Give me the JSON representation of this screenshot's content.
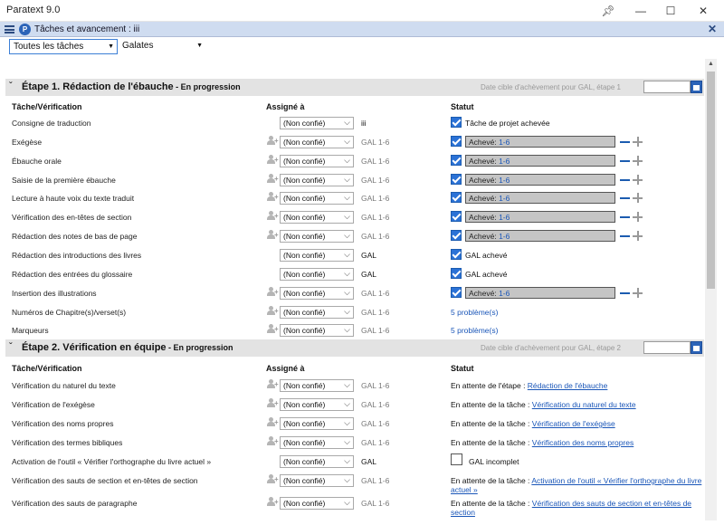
{
  "window": {
    "title": "Paratext 9.0"
  },
  "pane": {
    "title": "Tâches et avancement : iii"
  },
  "toolbar": {
    "filter_value": "Toutes les tâches",
    "book_value": "Galates"
  },
  "columns": {
    "task": "Tâche/Vérification",
    "assigned": "Assigné à",
    "status": "Statut"
  },
  "stage1": {
    "title": "Étape 1. Rédaction de l'ébauche",
    "status": " - En progression",
    "target_label": "Date cible d'achèvement pour GAL, étape 1",
    "rows": [
      {
        "task": "Consigne de traduction",
        "assigned": "(Non confié)",
        "scope": "iii",
        "status_text": "Tâche de projet achevée"
      },
      {
        "task": "Exégèse",
        "assigned": "(Non confié)",
        "scope": "GAL 1-6",
        "prog_label": "Achevé: ",
        "prog_value": "1-6"
      },
      {
        "task": "Ébauche orale",
        "assigned": "(Non confié)",
        "scope": "GAL 1-6",
        "prog_label": "Achevé: ",
        "prog_value": "1-6"
      },
      {
        "task": "Saisie de la première ébauche",
        "assigned": "(Non confié)",
        "scope": "GAL 1-6",
        "prog_label": "Achevé: ",
        "prog_value": "1-6"
      },
      {
        "task": "Lecture à haute voix du texte traduit",
        "assigned": "(Non confié)",
        "scope": "GAL 1-6",
        "prog_label": "Achevé: ",
        "prog_value": "1-6"
      },
      {
        "task": "Vérification des en-têtes de section",
        "assigned": "(Non confié)",
        "scope": "GAL 1-6",
        "prog_label": "Achevé: ",
        "prog_value": "1-6"
      },
      {
        "task": "Rédaction des notes de bas de page",
        "assigned": "(Non confié)",
        "scope": "GAL 1-6",
        "prog_label": "Achevé: ",
        "prog_value": "1-6"
      },
      {
        "task": "Rédaction des introductions des livres",
        "assigned": "(Non confié)",
        "scope": "GAL",
        "status_text": "GAL achevé"
      },
      {
        "task": "Rédaction des entrées du glossaire",
        "assigned": "(Non confié)",
        "scope": "GAL",
        "status_text": "GAL achevé"
      },
      {
        "task": "Insertion des illustrations",
        "assigned": "(Non confié)",
        "scope": "GAL 1-6",
        "prog_label": "Achevé: ",
        "prog_value": "1-6"
      },
      {
        "task": "Numéros de Chapitre(s)/verset(s)",
        "assigned": "(Non confié)",
        "scope": "GAL 1-6",
        "problems": "5 problème(s)"
      },
      {
        "task": "Marqueurs",
        "assigned": "(Non confié)",
        "scope": "GAL 1-6",
        "problems": "5 problème(s)"
      }
    ]
  },
  "stage2": {
    "title": "Étape 2. Vérification en équipe",
    "status": " - En progression",
    "target_label": "Date cible d'achèvement pour GAL, étape 2",
    "rows": [
      {
        "task": "Vérification du naturel du texte",
        "assigned": "(Non confié)",
        "scope": "GAL 1-6",
        "wait_prefix": "En attente de l'étape : ",
        "wait_link": "Rédaction de l'ébauche"
      },
      {
        "task": "Vérification de l'exégèse",
        "assigned": "(Non confié)",
        "scope": "GAL 1-6",
        "wait_prefix": "En attente de la tâche : ",
        "wait_link": "Vérification du naturel du texte"
      },
      {
        "task": "Vérification des noms propres",
        "assigned": "(Non confié)",
        "scope": "GAL 1-6",
        "wait_prefix": "En attente de la tâche : ",
        "wait_link": "Vérification de l'exégèse"
      },
      {
        "task": "Vérification des termes bibliques",
        "assigned": "(Non confié)",
        "scope": "GAL 1-6",
        "wait_prefix": "En attente de la tâche : ",
        "wait_link": "Vérification des noms propres"
      },
      {
        "task": "Activation de l'outil « Vérifier l'orthographe du livre actuel »",
        "assigned": "(Non confié)",
        "scope": "GAL",
        "status_text": "GAL incomplet"
      },
      {
        "task": "Vérification des sauts de section et en-têtes de section",
        "assigned": "(Non confié)",
        "scope": "GAL 1-6",
        "wait_prefix": "En attente de la tâche : ",
        "wait_link": "Activation de l'outil « Vérifier l'orthographe du livre actuel »"
      },
      {
        "task": "Vérification des sauts de paragraphe",
        "assigned": "(Non confié)",
        "scope": "GAL 1-6",
        "wait_prefix": "En attente de la tâche : ",
        "wait_link": "Vérification des sauts de section et en-têtes de section"
      }
    ]
  }
}
